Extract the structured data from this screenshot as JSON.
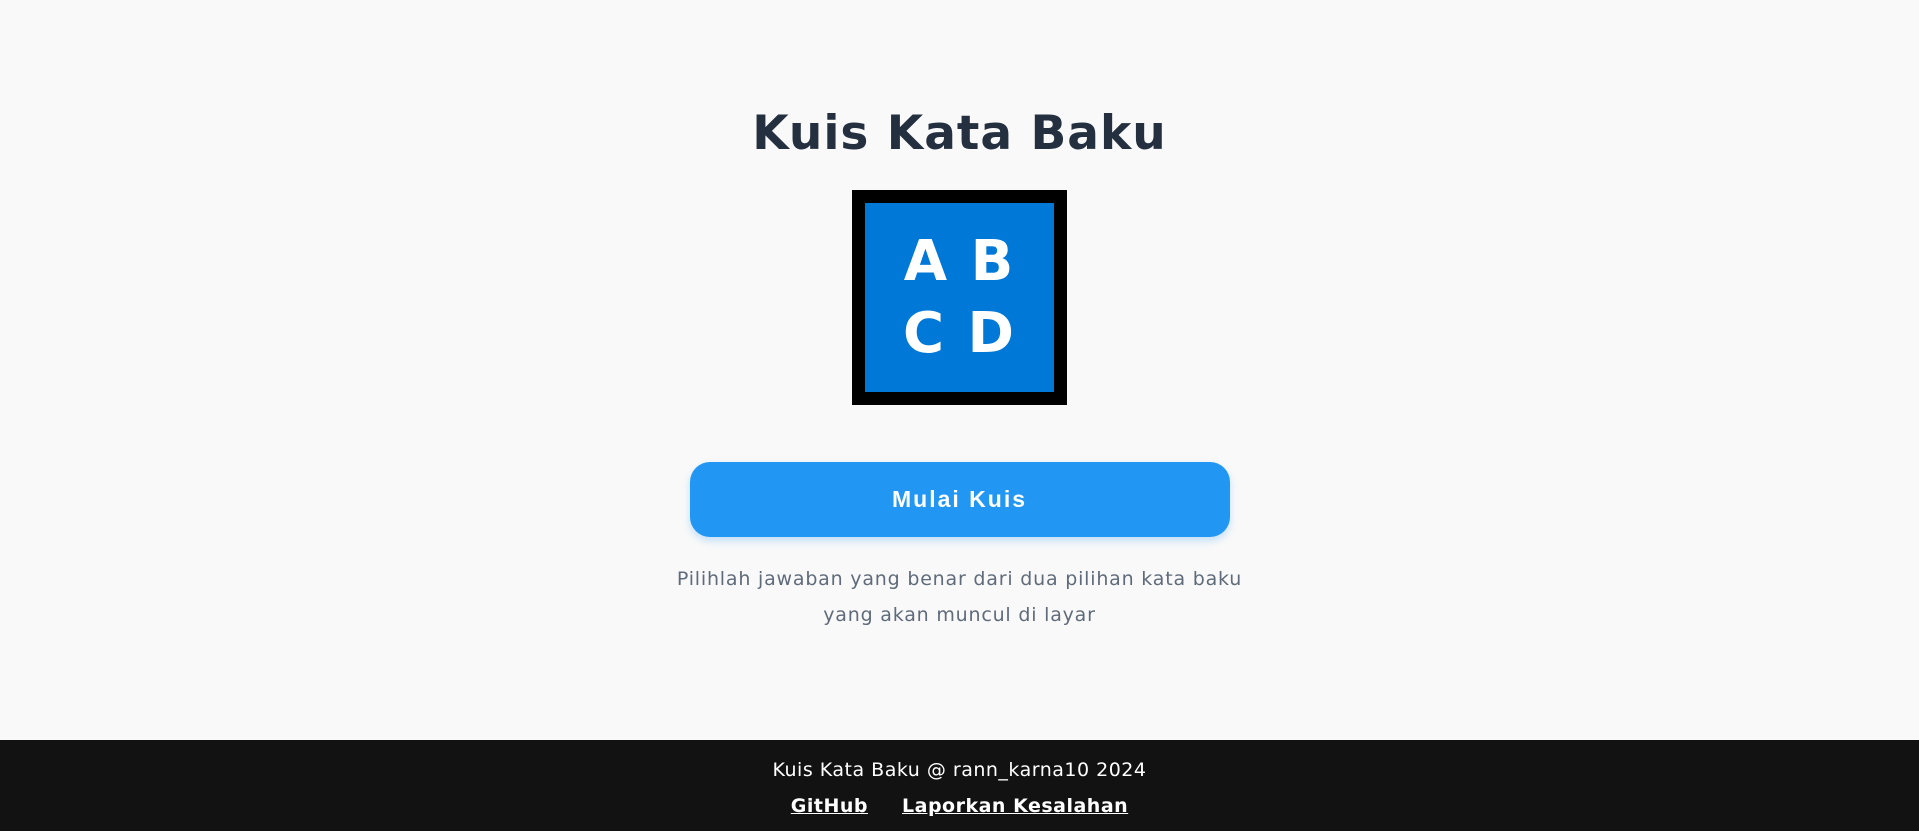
{
  "main": {
    "title": "Kuis Kata Baku",
    "logo": {
      "row1": "A B",
      "row2": "C D",
      "icon": "abcd-logo-icon",
      "frame_color": "#000000",
      "fill_color": "#0078d7"
    },
    "start_button_label": "Mulai Kuis",
    "start_button_color": "#2196f3",
    "instructions": "Pilihlah jawaban yang benar dari dua pilihan kata baku yang akan muncul di layar"
  },
  "footer": {
    "copyright": "Kuis Kata Baku @ rann_karna10 2024",
    "links": [
      {
        "label": "GitHub"
      },
      {
        "label": "Laporkan Kesalahan"
      }
    ]
  }
}
